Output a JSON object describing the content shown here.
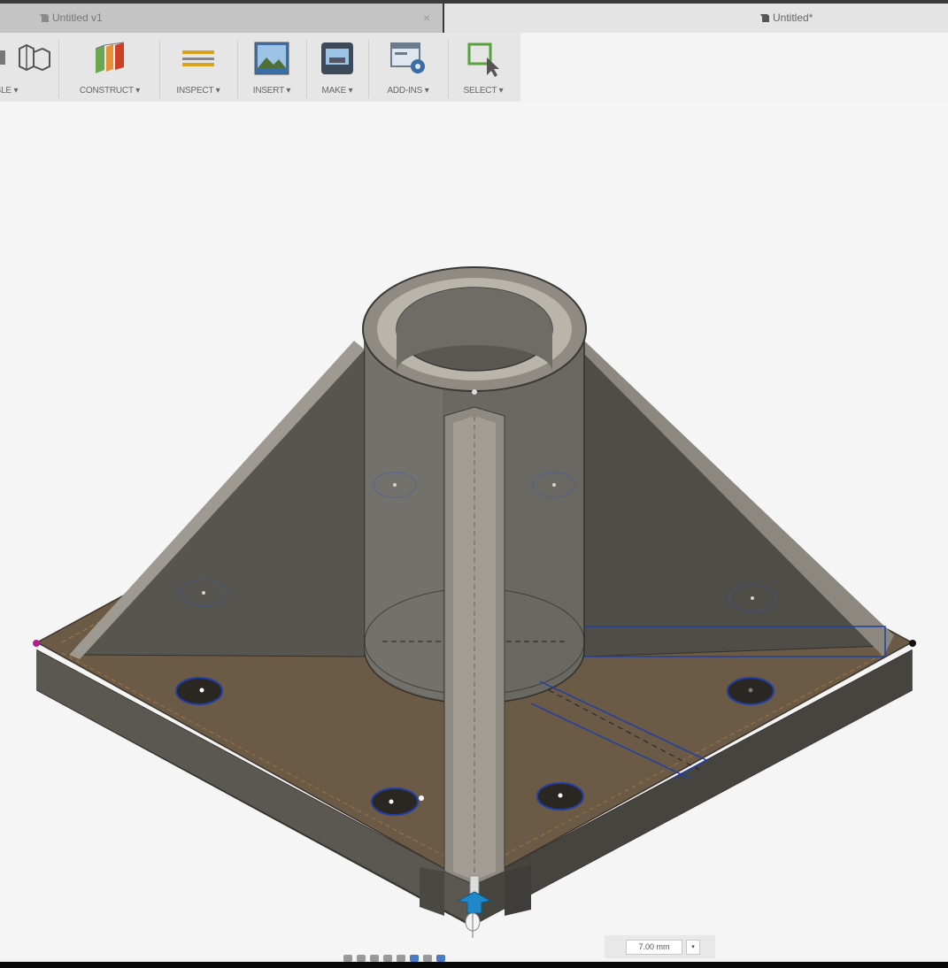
{
  "tabs": [
    {
      "label": "Untitled v1",
      "active": false,
      "close": "×"
    },
    {
      "label": "Untitled*",
      "active": true
    }
  ],
  "toolbar": {
    "groups": [
      {
        "label": "EMBLE ▾",
        "icon": "assemble-icon"
      },
      {
        "label": "CONSTRUCT ▾",
        "icon": "construct-icon"
      },
      {
        "label": "INSPECT ▾",
        "icon": "inspect-icon"
      },
      {
        "label": "INSERT ▾",
        "icon": "insert-icon"
      },
      {
        "label": "MAKE ▾",
        "icon": "make-icon"
      },
      {
        "label": "ADD-INS ▾",
        "icon": "add-ins-icon"
      },
      {
        "label": "SELECT ▾",
        "icon": "select-icon"
      }
    ]
  },
  "dimension": {
    "value": "7.00 mm",
    "dropdown": "▾"
  },
  "colors": {
    "plate_top": "#6b5a45",
    "body_gray": "#5c5a55",
    "edge_light": "#9a968d",
    "selection_blue": "#1f3fa6",
    "manipulator_blue": "#1e88c8"
  }
}
